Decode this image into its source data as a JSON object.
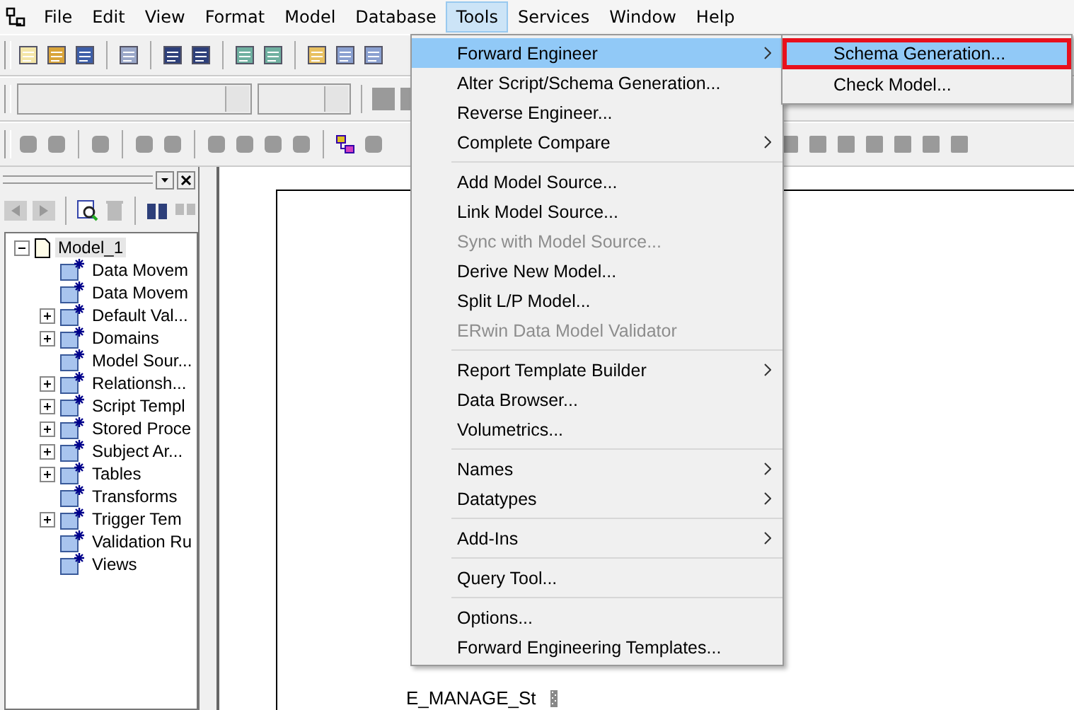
{
  "menubar": [
    {
      "label": "File",
      "selected": false
    },
    {
      "label": "Edit",
      "selected": false
    },
    {
      "label": "View",
      "selected": false
    },
    {
      "label": "Format",
      "selected": false
    },
    {
      "label": "Model",
      "selected": false
    },
    {
      "label": "Database",
      "selected": false
    },
    {
      "label": "Tools",
      "selected": true
    },
    {
      "label": "Services",
      "selected": false
    },
    {
      "label": "Window",
      "selected": false
    },
    {
      "label": "Help",
      "selected": false
    }
  ],
  "tools_menu": [
    {
      "kind": "item",
      "label": "Forward Engineer",
      "submenu": true,
      "selected": true,
      "disabled": false
    },
    {
      "kind": "item",
      "label": "Alter Script/Schema Generation...",
      "submenu": false,
      "selected": false,
      "disabled": false
    },
    {
      "kind": "item",
      "label": "Reverse Engineer...",
      "submenu": false,
      "selected": false,
      "disabled": false
    },
    {
      "kind": "item",
      "label": "Complete Compare",
      "submenu": true,
      "selected": false,
      "disabled": false
    },
    {
      "kind": "separator"
    },
    {
      "kind": "item",
      "label": "Add Model Source...",
      "submenu": false,
      "selected": false,
      "disabled": false
    },
    {
      "kind": "item",
      "label": "Link Model Source...",
      "submenu": false,
      "selected": false,
      "disabled": false
    },
    {
      "kind": "item",
      "label": "Sync with Model Source...",
      "submenu": false,
      "selected": false,
      "disabled": true
    },
    {
      "kind": "item",
      "label": "Derive New Model...",
      "submenu": false,
      "selected": false,
      "disabled": false
    },
    {
      "kind": "item",
      "label": "Split L/P Model...",
      "submenu": false,
      "selected": false,
      "disabled": false
    },
    {
      "kind": "item",
      "label": "ERwin Data Model Validator",
      "submenu": false,
      "selected": false,
      "disabled": true
    },
    {
      "kind": "separator"
    },
    {
      "kind": "item",
      "label": "Report Template Builder",
      "submenu": true,
      "selected": false,
      "disabled": false
    },
    {
      "kind": "item",
      "label": "Data Browser...",
      "submenu": false,
      "selected": false,
      "disabled": false
    },
    {
      "kind": "item",
      "label": "Volumetrics...",
      "submenu": false,
      "selected": false,
      "disabled": false
    },
    {
      "kind": "separator"
    },
    {
      "kind": "item",
      "label": "Names",
      "submenu": true,
      "selected": false,
      "disabled": false
    },
    {
      "kind": "item",
      "label": "Datatypes",
      "submenu": true,
      "selected": false,
      "disabled": false
    },
    {
      "kind": "separator"
    },
    {
      "kind": "item",
      "label": "Add-Ins",
      "submenu": true,
      "selected": false,
      "disabled": false
    },
    {
      "kind": "separator"
    },
    {
      "kind": "item",
      "label": "Query Tool...",
      "submenu": false,
      "selected": false,
      "disabled": false
    },
    {
      "kind": "separator"
    },
    {
      "kind": "item",
      "label": "Options...",
      "submenu": false,
      "selected": false,
      "disabled": false
    },
    {
      "kind": "item",
      "label": "Forward Engineering Templates...",
      "submenu": false,
      "selected": false,
      "disabled": false
    }
  ],
  "submenu": [
    {
      "label": "Schema Generation...",
      "selected": true,
      "highlighted_box": true
    },
    {
      "label": "Check Model...",
      "selected": false,
      "highlighted_box": false
    }
  ],
  "tree": {
    "label": "Model_1",
    "expanded": true,
    "selected": true,
    "children": [
      {
        "label": "Data Movem",
        "expandable": false,
        "selected": false
      },
      {
        "label": "Data Movem",
        "expandable": false,
        "selected": false
      },
      {
        "label": "Default Val...",
        "expandable": true,
        "selected": false
      },
      {
        "label": "Domains",
        "expandable": true,
        "selected": false
      },
      {
        "label": "Model Sour...",
        "expandable": false,
        "selected": false
      },
      {
        "label": "Relationsh...",
        "expandable": true,
        "selected": false
      },
      {
        "label": "Script Templ",
        "expandable": true,
        "selected": false
      },
      {
        "label": "Stored Proce",
        "expandable": true,
        "selected": false
      },
      {
        "label": "Subject Ar...",
        "expandable": true,
        "selected": false
      },
      {
        "label": "Tables",
        "expandable": true,
        "selected": false
      },
      {
        "label": "Transforms",
        "expandable": false,
        "selected": false
      },
      {
        "label": "Trigger Tem",
        "expandable": true,
        "selected": false
      },
      {
        "label": "Validation Ru",
        "expandable": false,
        "selected": false
      },
      {
        "label": "Views",
        "expandable": false,
        "selected": false
      }
    ]
  },
  "canvas": {
    "entity_text": "E_MANAGE_St"
  }
}
